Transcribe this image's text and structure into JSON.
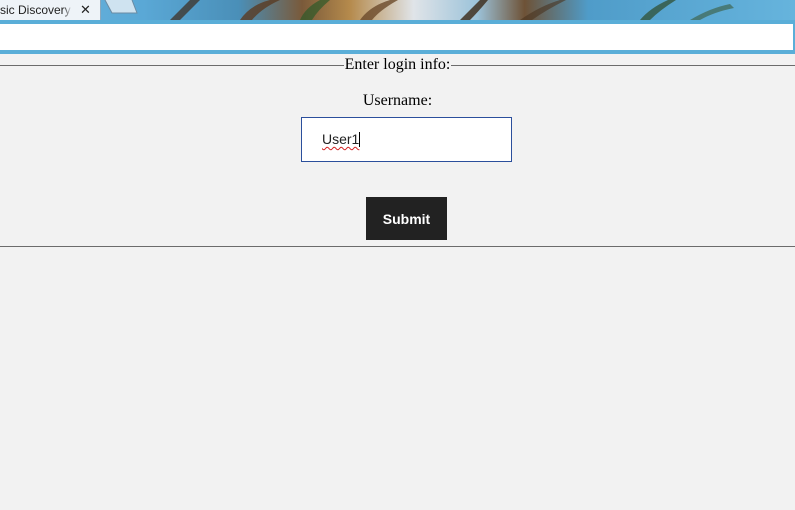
{
  "browser": {
    "tab_title": "sic Discovery",
    "tab_close_glyph": "✕",
    "icons": [
      "close-icon",
      "new-tab-icon"
    ],
    "accent_color": "#5aaed8"
  },
  "form": {
    "legend": "Enter login info:",
    "username_label": "Username:",
    "username_value": "User1",
    "submit_label": "Submit",
    "button_color": "#222222",
    "input_border_color": "#2b4f9c"
  }
}
